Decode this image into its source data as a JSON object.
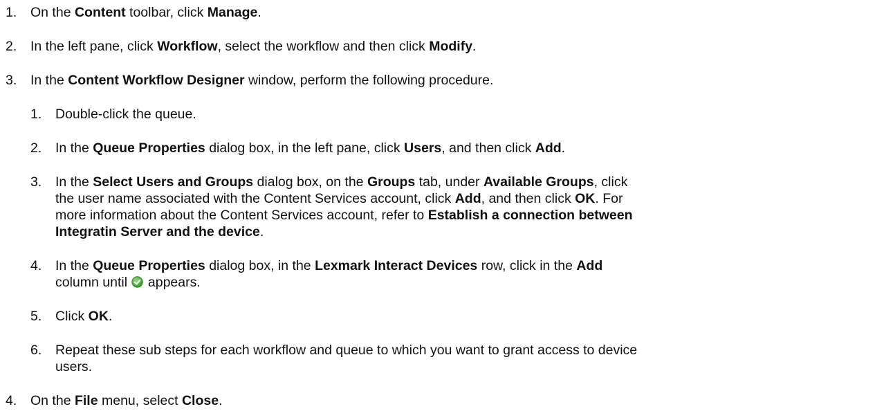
{
  "steps": [
    {
      "num": "1.",
      "parts": [
        "On the ",
        "Content",
        " toolbar, click ",
        "Manage",
        "."
      ]
    },
    {
      "num": "2.",
      "parts": [
        "In the left pane, click ",
        "Workflow",
        ", select the workflow and then click ",
        "Modify",
        "."
      ]
    },
    {
      "num": "3.",
      "parts": [
        "In the ",
        "Content Workflow Designer",
        " window, perform the following procedure."
      ],
      "substeps": [
        {
          "num": "1.",
          "parts": [
            "Double-click the queue."
          ]
        },
        {
          "num": "2.",
          "parts": [
            "In the ",
            "Queue Properties",
            " dialog box, in the left pane, click ",
            "Users",
            ", and then click ",
            "Add",
            "."
          ]
        },
        {
          "num": "3.",
          "line1": [
            "In the ",
            "Select Users and Groups",
            " dialog box, on the ",
            "Groups",
            " tab, under ",
            "Available Groups",
            ", click"
          ],
          "line2": [
            "the user name associated with the Content Services account, click ",
            "Add",
            ", and then click ",
            "OK",
            ". For"
          ],
          "line3": [
            "more information about the Content Services account, refer to ",
            "Establish a connection between"
          ],
          "line4": [
            "Integratin Server and the device",
            "."
          ]
        },
        {
          "num": "4.",
          "line1": [
            "In the ",
            "Queue Properties",
            " dialog box, in the ",
            "Lexmark Interact Devices",
            " row, click in the ",
            "Add"
          ],
          "line2a": "column until ",
          "line2b": " appears."
        },
        {
          "num": "5.",
          "parts": [
            "Click ",
            "OK",
            "."
          ]
        },
        {
          "num": "6.",
          "line1": "Repeat these sub steps for each workflow and queue to which you want to grant access to device",
          "line2": "users."
        }
      ]
    },
    {
      "num": "4.",
      "parts": [
        "On the ",
        "File",
        " menu, select ",
        "Close",
        "."
      ]
    }
  ],
  "icons": {
    "checkmark": "green-check-icon"
  },
  "colors": {
    "check_green": "#3cae2c",
    "text": "#111111"
  }
}
